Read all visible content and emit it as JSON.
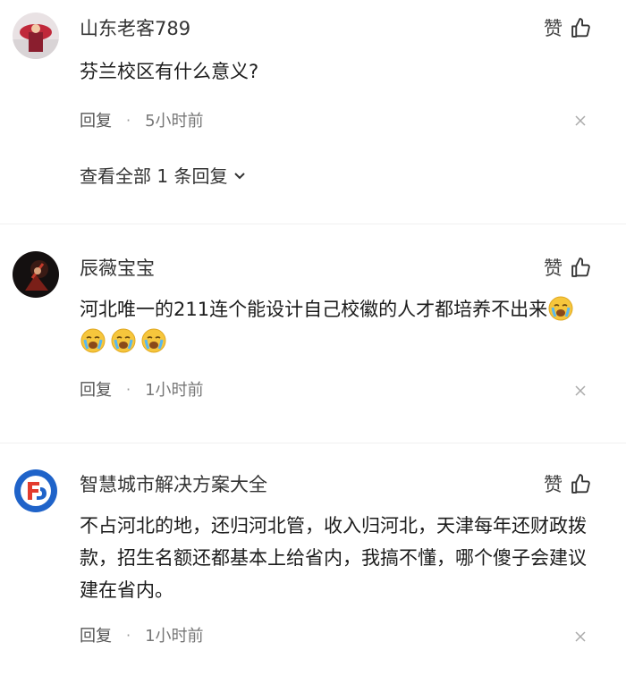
{
  "comments": [
    {
      "username": "山东老客789",
      "like_label": "赞",
      "text": "芬兰校区有什么意义?",
      "reply_label": "回复",
      "separator": "·",
      "time": "5小时前",
      "view_all": "查看全部 1 条回复"
    },
    {
      "username": "辰薇宝宝",
      "like_label": "赞",
      "text": "河北唯一的211连个能设计自己校徽的人才都培养不出来",
      "emoji_name": "crying-face-icon",
      "emoji_count": 4,
      "reply_label": "回复",
      "separator": "·",
      "time": "1小时前"
    },
    {
      "username": "智慧城市解决方案大全",
      "like_label": "赞",
      "text": "不占河北的地，还归河北管，收入归河北，天津每年还财政拨款，招生名额还都基本上给省内，我搞不懂，哪个傻子会建议建在省内。",
      "reply_label": "回复",
      "separator": "·",
      "time": "1小时前"
    }
  ],
  "colors": {
    "text": "#1c1c1c",
    "meta": "#555555",
    "muted": "#999999",
    "avatar3_blue": "#1f63c9",
    "avatar3_red": "#e33b2e"
  }
}
